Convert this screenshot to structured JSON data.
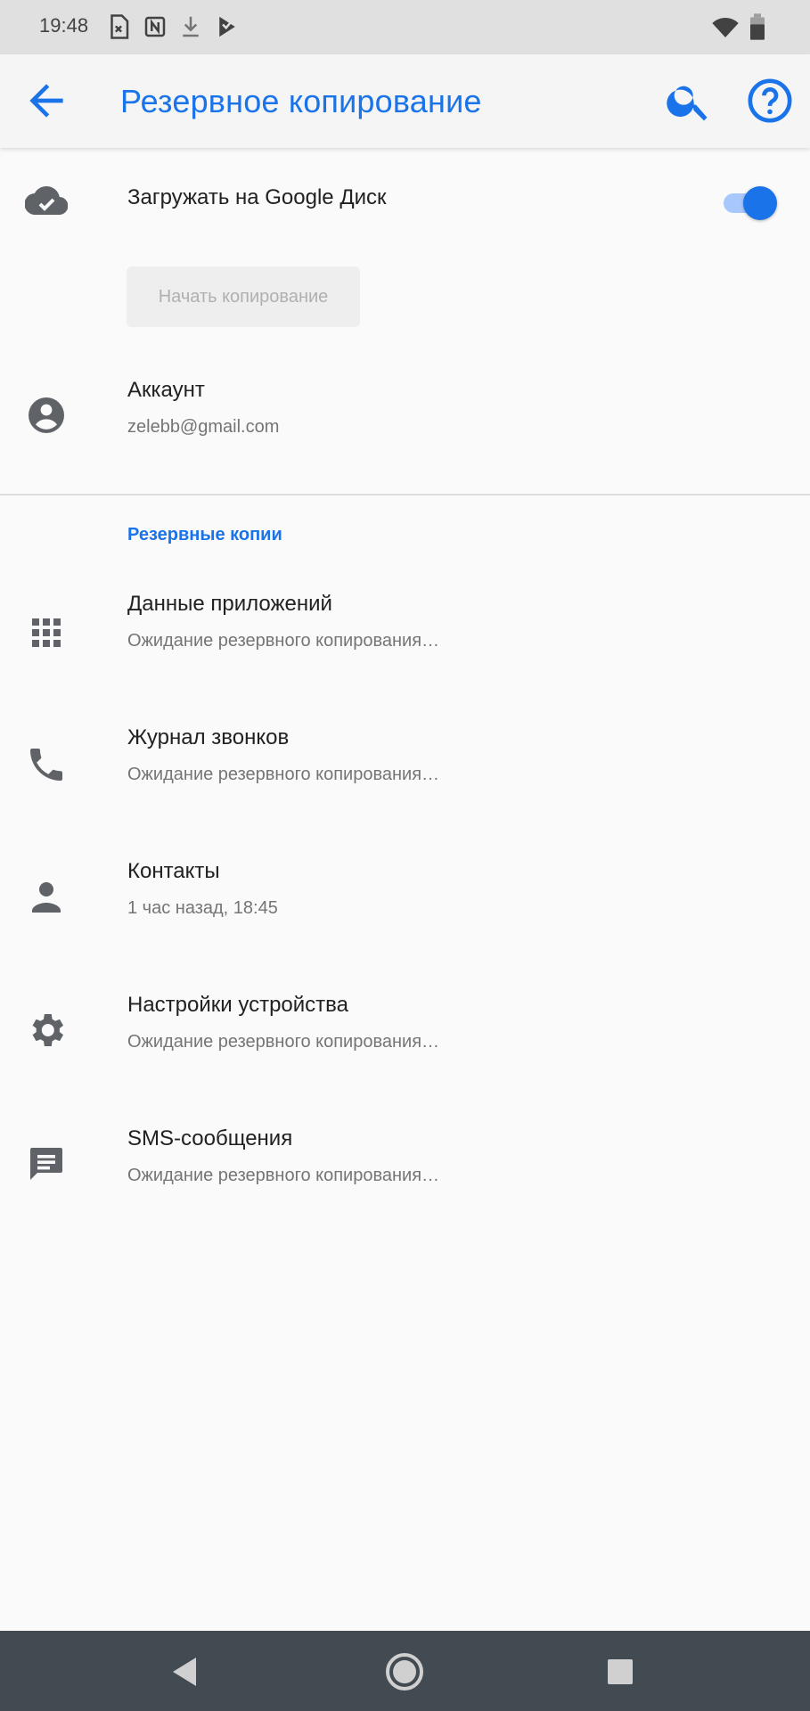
{
  "status_bar": {
    "time": "19:48"
  },
  "app_bar": {
    "title": "Резервное копирование"
  },
  "drive_upload": {
    "label": "Загружать на Google Диск",
    "enabled": true
  },
  "start_backup_button": {
    "label": "Начать копирование"
  },
  "account": {
    "label": "Аккаунт",
    "email": "zelebb@gmail.com"
  },
  "section": {
    "title": "Резервные копии"
  },
  "backup_items": [
    {
      "label": "Данные приложений",
      "status": "Ожидание резервного копирования…",
      "icon": "apps-icon"
    },
    {
      "label": "Журнал звонков",
      "status": "Ожидание резервного копирования…",
      "icon": "phone-icon"
    },
    {
      "label": "Контакты",
      "status": "1 час назад, 18:45",
      "icon": "person-icon"
    },
    {
      "label": "Настройки устройства",
      "status": "Ожидание резервного копирования…",
      "icon": "gear-icon"
    },
    {
      "label": "SMS-сообщения",
      "status": "Ожидание резервного копирования…",
      "icon": "message-icon"
    }
  ],
  "colors": {
    "accent": "#1a73e8",
    "toggle_track": "#a8c7fa",
    "nav_bar": "#424a52"
  }
}
